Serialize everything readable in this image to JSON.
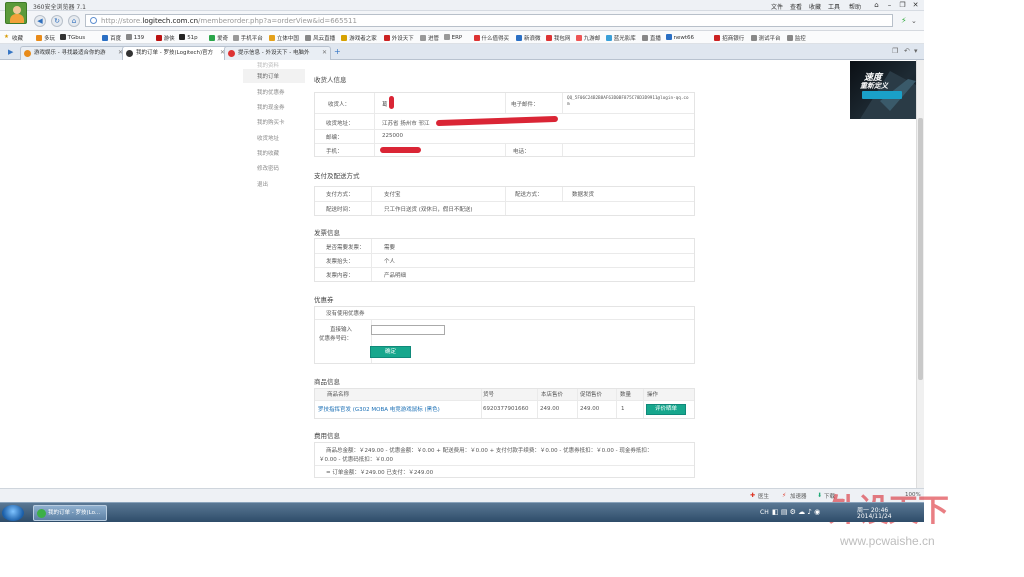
{
  "browser": {
    "title": "360安全浏览器 7.1",
    "menu": [
      "文件",
      "查看",
      "收藏",
      "工具",
      "帮助"
    ],
    "url_prefix": "http://store.",
    "url_domain": "logitech.com.cn",
    "url_rest": "/memberorder.php?a=orderView&id=665511",
    "bookmarks_label": "收藏",
    "bookmarks": [
      "多玩",
      "TGbus",
      "百度",
      "139",
      "游侠",
      "51p",
      "爱奇",
      "手机平台",
      "立体中国",
      "风云直播",
      "游戏者之家",
      "外设天下",
      "进管",
      "ERP",
      "什么值得买",
      "新浪微",
      "我包网",
      "九游邮",
      "蓝光影库",
      "直播",
      "newt66",
      "招商银行",
      "测试平台",
      "监控"
    ],
    "tabs": [
      {
        "label": "游戏娱乐 - 寻找最适合你的游",
        "active": false
      },
      {
        "label": "我的订单 - 罗技(Logitech)官方",
        "active": true
      },
      {
        "label": "提示信息 - 外设天下 - 电脑外",
        "active": false
      }
    ]
  },
  "sidebar": {
    "items": [
      "我的订单",
      "我的优惠券",
      "我的现金券",
      "我的购买卡",
      "收货地址",
      "我的收藏",
      "修改密码",
      "退出"
    ],
    "cut_item": "我的资料"
  },
  "receiver": {
    "section": "收货人信息",
    "name_label": "收货人：",
    "name_value": "葛",
    "email_label": "电子邮件：",
    "email_value": "QQ_5F06C24B2B8AF63D0BF875C78D3D9911@login-qq.com",
    "address_label": "收货地址：",
    "address_value": "江苏省  扬州市  邗江",
    "zip_label": "邮编：",
    "zip_value": "225000",
    "mobile_label": "手机：",
    "phone_label": "电话："
  },
  "payment": {
    "section": "支付及配送方式",
    "method_label": "支付方式：",
    "method_value": "支付宝",
    "ship_label": "配送方式：",
    "ship_value": "数据发货",
    "time_label": "配送时间：",
    "time_value": "只工作日送货 (双休日，假日不配送)"
  },
  "invoice": {
    "section": "发票信息",
    "need_label": "是否需要发票：",
    "need_value": "需要",
    "title_label": "发票抬头：",
    "title_value": "个人",
    "content_label": "发票内容：",
    "content_value": "产品明细"
  },
  "coupon": {
    "section": "优惠券",
    "none_text": "没有使用优惠券",
    "input_label1": "直接输入",
    "input_label2": "优惠券号码：",
    "input_value": "",
    "confirm_button": "确定"
  },
  "goods": {
    "section": "商品信息",
    "headers": [
      "商品名称",
      "货号",
      "本店售价",
      "促销售价",
      "数量",
      "操作"
    ],
    "rows": [
      {
        "name": "罗技指挥官发 (G302 MOBA 电竞游戏鼠标 (黑色)",
        "sku": "6920377901660",
        "price": "249.00",
        "promo": "249.00",
        "qty": "1",
        "action": "评价晒单"
      }
    ]
  },
  "fees": {
    "section": "费用信息",
    "line1": "商品总金额：￥249.00 - 优惠金额：￥0.00 + 配送费用：￥0.00 + 支付付款手续费：￥0.00 - 优惠券抵扣：￥0.00 - 现金券抵扣：",
    "line2": "￥0.00 - 优惠码抵扣：￥0.00",
    "total": "= 订单金额：￥249.00  已支付：￥249.00"
  },
  "status_bar": {
    "items": [
      "医生",
      "加速器",
      "下载",
      "100%"
    ]
  },
  "taskbar": {
    "task_label": "我的订单 - 罗技(Lo...",
    "lang": "CH",
    "time": "周一 20:46",
    "date": "2014/11/24"
  },
  "watermark": {
    "brand": "外设天下",
    "site": "www.pcwaishe.cn"
  },
  "ad": {
    "line1": "速度",
    "line2": "重新定义"
  },
  "colors": {
    "accent": "#17a78d",
    "link": "#1a6fb5",
    "redact": "#d8192a"
  }
}
